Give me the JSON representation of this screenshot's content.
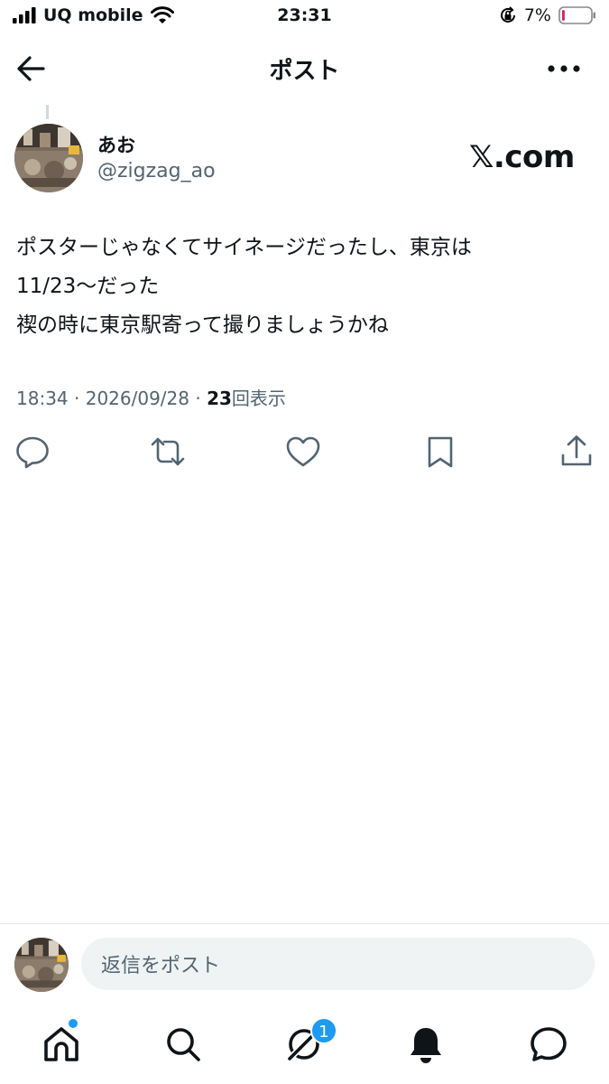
{
  "status_bar": {
    "carrier": "UQ mobile",
    "time": "23:31",
    "battery_percent": "7%",
    "battery_level": 0.07,
    "icons": [
      "signal-icon",
      "wifi-icon",
      "orientation-lock-icon",
      "battery-icon"
    ]
  },
  "header": {
    "title": "ポスト",
    "back_icon": "arrow-left-icon",
    "more_icon": "more-horizontal-icon"
  },
  "post": {
    "display_name": "あお",
    "handle": "@zigzag_ao",
    "brand_badge": "𝕏.com",
    "body_lines": [
      "ポスターじゃなくてサイネージだったし、東京は",
      "11/23〜だった",
      "禊の時に東京駅寄って撮りましょうかね"
    ],
    "time": "18:34",
    "date": "2026/09/28",
    "separator": "·",
    "views_count": "23",
    "views_label": "回表示",
    "actions": [
      "reply-icon",
      "repost-icon",
      "like-icon",
      "bookmark-icon",
      "share-icon"
    ]
  },
  "reply_bar": {
    "placeholder": "返信をポスト"
  },
  "nav": {
    "items": [
      "home-icon",
      "search-icon",
      "grok-icon",
      "notifications-icon",
      "messages-icon"
    ],
    "grok_badge": "1"
  },
  "colors": {
    "text": "#0f1419",
    "secondary": "#536471",
    "accent": "#1d9bf0",
    "battery_low": "#e0245e",
    "input_bg": "#eff3f4"
  }
}
